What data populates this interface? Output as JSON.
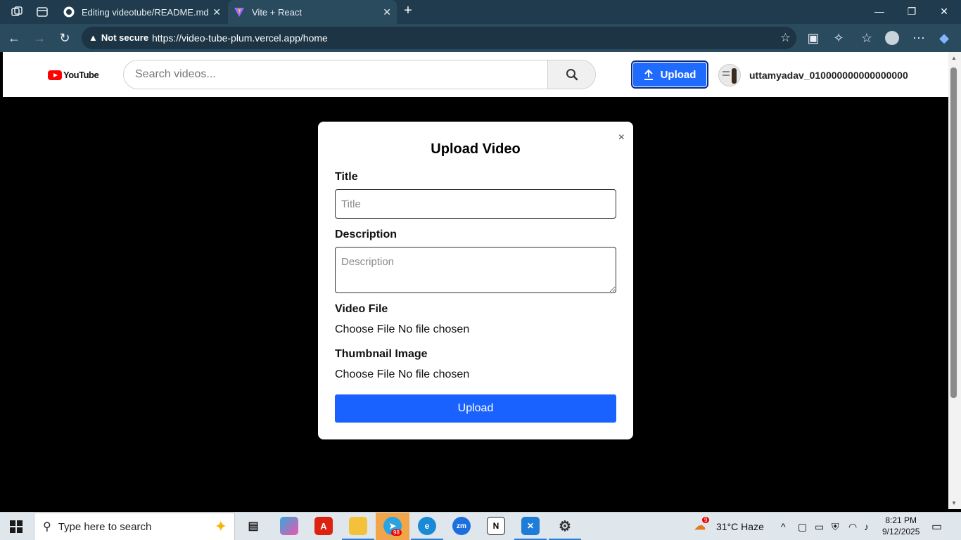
{
  "browser": {
    "tabs": [
      {
        "label": "Editing videotube/README.md at",
        "icon": "github-icon",
        "active": false
      },
      {
        "label": "Vite + React",
        "icon": "vite-icon",
        "active": true
      }
    ],
    "security_label": "Not secure",
    "url": "https://video-tube-plum.vercel.app/home"
  },
  "header": {
    "logo_text": "YouTube",
    "search_placeholder": "Search videos...",
    "upload_label": "Upload",
    "username": "uttamyadav_010000000000000000"
  },
  "modal": {
    "title": "Upload Video",
    "close_glyph": "×",
    "title_label": "Title",
    "title_placeholder": "Title",
    "description_label": "Description",
    "description_placeholder": "Description",
    "video_label": "Video File",
    "video_choose": "Choose File",
    "video_status": "No file chosen",
    "thumbnail_label": "Thumbnail Image",
    "thumbnail_choose": "Choose File",
    "thumbnail_status": "No file chosen",
    "submit_label": "Upload"
  },
  "taskbar": {
    "search_placeholder": "Type here to search",
    "telegram_badge": "98",
    "weather_badge": "9",
    "weather_text": "31°C  Haze",
    "time": "8:21 PM",
    "date": "9/12/2025"
  },
  "colors": {
    "accent_blue": "#1a62ff",
    "chrome_bg": "#1f3b4d",
    "youtube_red": "#ff0000"
  }
}
